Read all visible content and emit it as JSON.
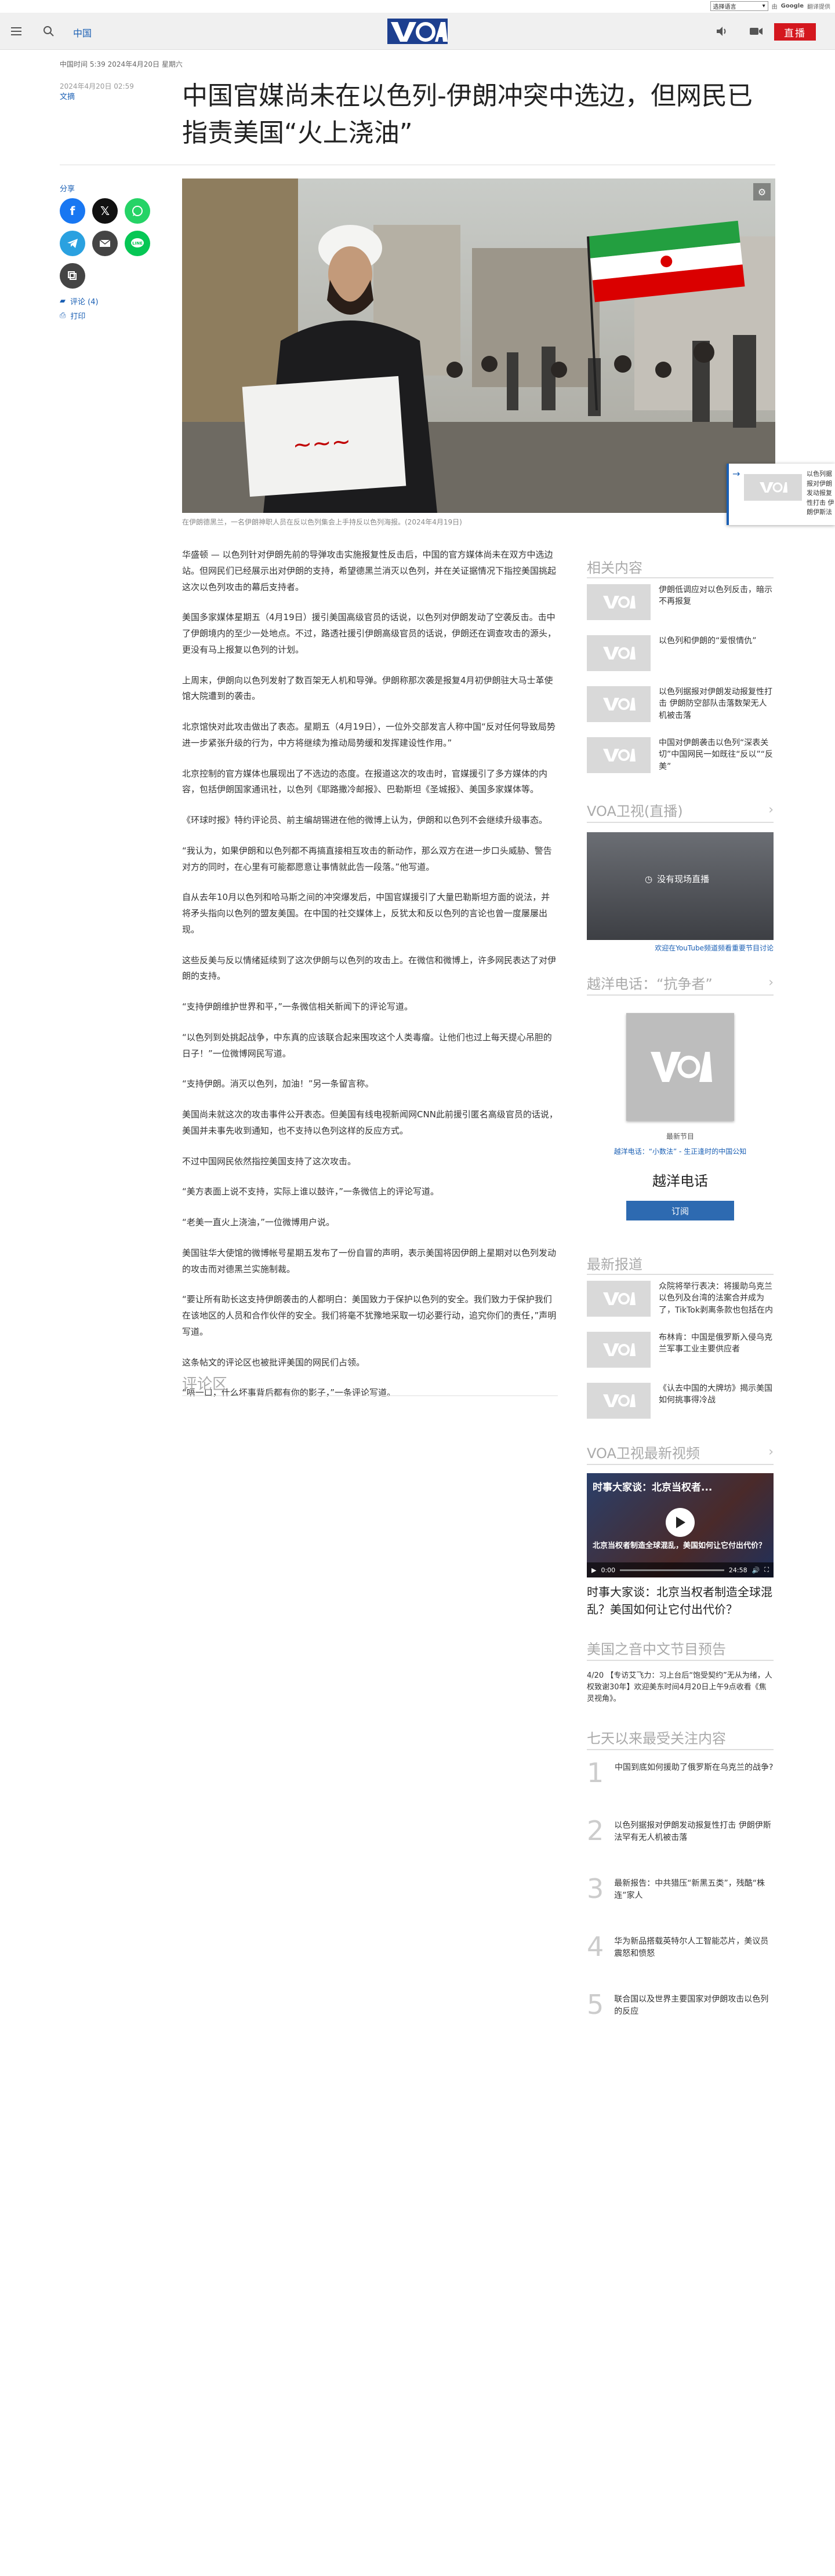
{
  "translate": {
    "select_label": "选择语言",
    "powered_prefix": "由",
    "google_label": "Google",
    "powered_suffix": "翻译提供"
  },
  "header": {
    "language": "中国",
    "logo": "VOA",
    "live_label": "直播"
  },
  "dateline": "中国时间 5:39 2024年4月20日 星期六",
  "article": {
    "published": "2024年4月20日 02:59",
    "section": "文摘",
    "title": "中国官媒尚未在以色列-伊朗冲突中选边，但网民已指责美国“火上浇油”",
    "caption": "在伊朗德黑兰，一名伊朗神职人员在反以色列集会上手持反以色列海报。(2024年4月19日)",
    "paragraphs": [
      "华盛顿 — 以色列针对伊朗先前的导弹攻击实施报复性反击后，中国的官方媒体尚未在双方中选边站。但网民们已经展示出对伊朗的支持，希望德黑兰消灭以色列，并在关证据情况下指控美国挑起这次以色列攻击的幕后支持者。",
      "美国多家媒体星期五（4月19日）援引美国高级官员的话说，以色列对伊朗发动了空袭反击。击中了伊朗境内的至少一处地点。不过，路透社援引伊朗高级官员的话说，伊朗还在调查攻击的源头，更没有马上报复以色列的计划。",
      "上周末，伊朗向以色列发射了数百架无人机和导弹。伊朗称那次袭是报复4月初伊朗驻大马士革使馆大院遭到的袭击。",
      "北京馆快对此攻击做出了表态。星期五（4月19日），一位外交部发言人称中国“反对任何导致局势进一步紧张升级的行为，中方将继续为推动局势缓和发挥建设性作用。”",
      "北京控制的官方媒体也展现出了不选边的态度。在报道这次的攻击时，官媒援引了多方媒体的内容，包括伊朗国家通讯社，以色列《耶路撒冷邮报》、巴勒斯坦《圣城报》、美国多家媒体等。",
      "《环球时报》特约评论员、前主编胡锡进在他的微博上认为，伊朗和以色列不会继续升级事态。",
      "“我认为，如果伊朗和以色列都不再搞直接相互攻击的新动作，那么双方在进一步口头威胁、警告对方的同时，在心里有可能都愿意让事情就此告一段落。”他写道。",
      "自从去年10月以色列和哈马斯之间的冲突爆发后，中国官媒援引了大量巴勒斯坦方面的说法，并将矛头指向以色列的盟友美国。在中国的社交媒体上，反犹太和反以色列的言论也曾一度屡屡出现。",
      "这些反美与反以情绪延续到了这次伊朗与以色列的攻击上。在微信和微博上，许多网民表达了对伊朗的支持。",
      "“支持伊朗维护世界和平，”一条微信相关新闻下的评论写道。",
      "“以色列到处挑起战争，中东真的应该联合起来围攻这个人类毒瘤。让他们也过上每天提心吊胆的日子！”一位微博网民写道。",
      "“支持伊朗。消灭以色列，加油！”另一条留言称。",
      "美国尚未就这次的攻击事件公开表态。但美国有线电视新闻网CNN此前援引匿名高级官员的话说，美国并未事先收到通知，也不支持以色列这样的反应方式。",
      "不过中国网民依然指控美国支持了这次攻击。",
      "“美方表面上说不支持，实际上谁以鼓许，”一条微信上的评论写道。",
      "“老美一直火上浇油，”一位微博用户说。",
      "美国驻华大使馆的微博帐号星期五发布了一份自冒的声明，表示美国将因伊朗上星期对以色列发动的攻击而对德黑兰实施制裁。",
      "“要让所有助长这支持伊朗袭击的人都明白：美国致力于保护以色列的安全。我们致力于保护我们在该地区的人员和合作伙伴的安全。我们将毫不犹豫地采取一切必要行动，追究你们的责任，”声明写道。",
      "这条帖文的评论区也被批评美国的网民们占领。",
      "“唔一口，什么坏事背后都有你的影子，”一条评论写道。"
    ]
  },
  "share": {
    "label": "分享",
    "comments": "评论 (4)",
    "print": "打印"
  },
  "comments_title": "评论区",
  "sidebar": {
    "related_title": "相关内容",
    "related": [
      "伊朗低调应对以色列反击，暗示不再报复",
      "以色列和伊朗的“爱恨情仇”",
      "以色列据报对伊朗发动报复性打击 伊朗防空部队击落数架无人机被击落",
      "中国对伊朗袭击以色列“深表关切”中国网民一如既往“反以”“反美”"
    ],
    "live_title": "VOA卫视(直播)",
    "live_status": "没有现场直播",
    "live_sub": "欢迎在YouTube频道频看重要节目讨论",
    "podcast_title": "越洋电话：“抗争者”",
    "podcast_label": "最新节目",
    "podcast_desc": "越洋电话：“小数法” - 生正逢时的中国公知",
    "podcast_name": "越洋电话",
    "subscribe": "订阅",
    "latest_title": "最新报道",
    "latest": [
      "众院将举行表决：将援助乌克兰以色列及台湾的法案合并成为了，TikTok剥离条款也包括在内",
      "布林肯：中国是俄罗斯入侵乌克兰军事工业主要供应者",
      "《认去中国的大牌坊》揭示美国如何挑事得冷战"
    ],
    "video_title": "VOA卫视最新视频",
    "video_overlay_top": "时事大家谈：北京当权者...",
    "video_overlay_bottom": "北京当权者制造全球混乱，美国如何让它付出代价？",
    "video_time": "0:00",
    "video_duration": "24:58",
    "video_caption": "时事大家谈：北京当权者制造全球混乱？美国如何让它付出代价？",
    "roundup_title": "美国之音中文节目预告",
    "roundup_text": "4/20 【专访艾飞力：习上台后“饱受契约”无从为绪，人权致谢30年】欢迎美东时间4月20日上午9点收看《焦灵视角》。",
    "popular_title": "七天以来最受关注内容",
    "popular": [
      {
        "n": "1",
        "t": "中国到底如何援助了俄罗斯在乌克兰的战争?"
      },
      {
        "n": "2",
        "t": "以色列据报对伊朗发动报复性打击 伊朗伊斯法罕有无人机被击落"
      },
      {
        "n": "3",
        "t": "最新报告：中共猎压“新黑五类”，残酷“株连”家人"
      },
      {
        "n": "4",
        "t": "华为新品搭载英特尔人工智能芯片，美议员震怒和愤怒"
      },
      {
        "n": "5",
        "t": "联合国以及世界主要国家对伊朗攻击以色列的反应"
      }
    ]
  },
  "teaser": {
    "text": "以色列据报对伊朗发动报复性打击 伊朗伊斯法罕有无人机被击落"
  },
  "colors": {
    "accent": "#1a5fb4",
    "live_red": "#d4171e",
    "subscribe_blue": "#2d6ab1"
  }
}
